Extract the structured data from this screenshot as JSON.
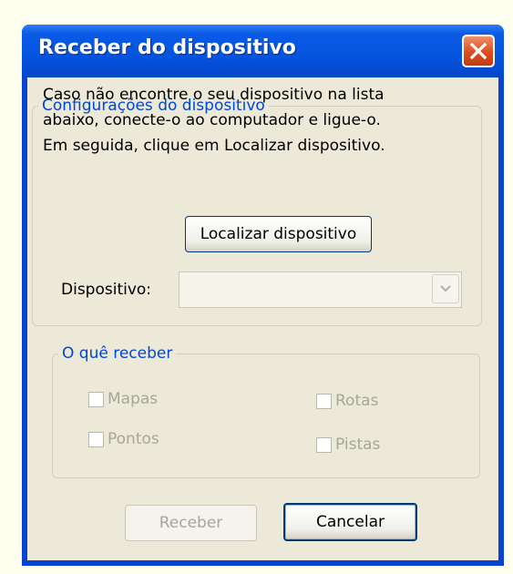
{
  "dialog": {
    "title": "Receber do dispositivo",
    "close_icon": "close-icon",
    "colors": {
      "titlebar": "#0555e1",
      "close_button": "#dd4c20",
      "group_legend": "#0046d5",
      "client_bg": "#ece9d8",
      "disabled_text": "#a6a69b"
    }
  },
  "device_group": {
    "legend": "Configurações do dispositivo",
    "description": [
      "Caso não encontre o seu dispositivo na lista",
      "abaixo, conecte-o ao computador e ligue-o.",
      "Em seguida, clique em Localizar dispositivo."
    ],
    "find_button": "Localizar dispositivo",
    "device_label": "Dispositivo:",
    "device_value": "",
    "dropdown_icon": "chevron-down-icon"
  },
  "receive_group": {
    "legend": "O quê receber",
    "options": {
      "maps": {
        "label": "Mapas",
        "checked": false
      },
      "points": {
        "label": "Pontos",
        "checked": false
      },
      "routes": {
        "label": "Rotas",
        "checked": false
      },
      "tracks": {
        "label": "Pistas",
        "checked": false
      }
    }
  },
  "footer": {
    "receive_button": "Receber",
    "cancel_button": "Cancelar"
  }
}
